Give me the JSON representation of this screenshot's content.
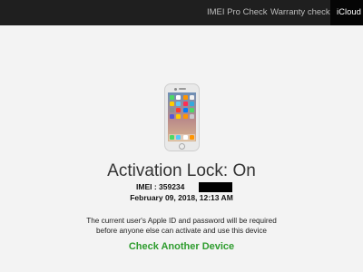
{
  "nav": {
    "items": [
      {
        "label": "IMEI Pro Check"
      },
      {
        "label": "Warranty check"
      },
      {
        "label": "iCloud C"
      }
    ]
  },
  "status": {
    "title": "Activation Lock: On",
    "imei_label": "IMEI : 359234",
    "date": "February 09, 2018, 12:13 AM"
  },
  "notice": {
    "line1": "The current user's Apple ID and password will be required",
    "line2": "before anyone else can activate and use this device"
  },
  "actions": {
    "check_another": "Check Another Device"
  },
  "colors": {
    "navbar": "#1f1f1f",
    "active_tab": "#050505",
    "link_green": "#2e9c2e",
    "background": "#f3f3f3"
  },
  "icons": {
    "phone": "iphone-icon"
  }
}
